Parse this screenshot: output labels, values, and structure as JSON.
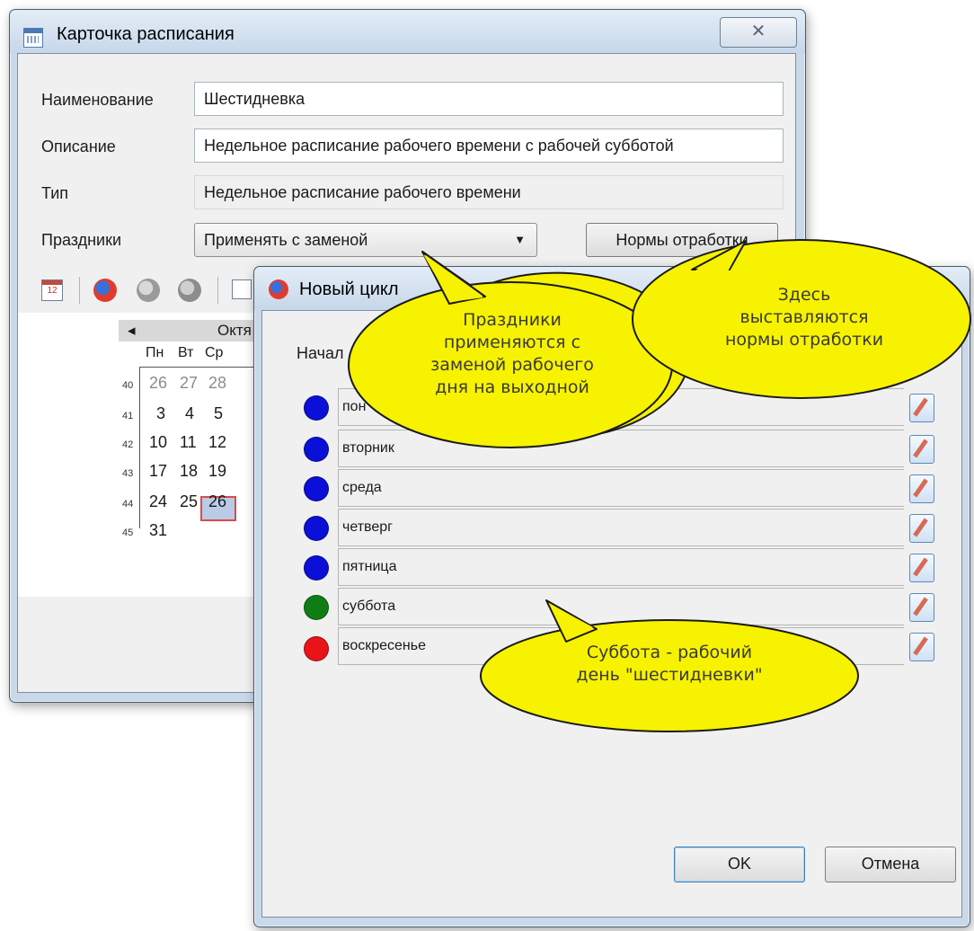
{
  "schedule_window": {
    "title": "Карточка расписания",
    "close_glyph": "✕",
    "fields": [
      {
        "label": "Наименование",
        "value": "Шестидневка"
      },
      {
        "label": "Описание",
        "value": "Недельное расписание рабочего времени с рабочей субботой"
      },
      {
        "label": "Тип",
        "value": "Недельное расписание рабочего времени"
      }
    ],
    "holidays": {
      "label": "Праздники",
      "selected": "Применять с заменой"
    },
    "norms_button": "Нормы отработки",
    "calendar": {
      "month_partial": "Октя",
      "nav_prev": "◂",
      "day_headers": [
        "Пн",
        "Вт",
        "Ср"
      ],
      "weeks": [
        {
          "num": "40",
          "days": [
            "26",
            "27",
            "28"
          ]
        },
        {
          "num": "41",
          "days": [
            "3",
            "4",
            "5"
          ]
        },
        {
          "num": "42",
          "days": [
            "10",
            "11",
            "12"
          ]
        },
        {
          "num": "43",
          "days": [
            "17",
            "18",
            "19"
          ]
        },
        {
          "num": "44",
          "days": [
            "24",
            "25",
            "26"
          ]
        },
        {
          "num": "45",
          "days": [
            "31"
          ]
        }
      ],
      "today": "26"
    }
  },
  "cycle_window": {
    "title_partial": "Новый цикл",
    "start_label_partial": "Начал",
    "days": [
      {
        "name": "пон",
        "color": "#0a10d8"
      },
      {
        "name": "вторник",
        "color": "#0a10d8"
      },
      {
        "name": "среда",
        "color": "#0a10d8"
      },
      {
        "name": "четверг",
        "color": "#0a10d8"
      },
      {
        "name": "пятница",
        "color": "#0a10d8"
      },
      {
        "name": "суббота",
        "color": "#107d14"
      },
      {
        "name": "воскресенье",
        "color": "#e8141a"
      }
    ],
    "ok_button": "OK",
    "cancel_button": "Отмена"
  },
  "callouts": {
    "holidays": [
      "Праздники",
      "применяются с",
      "заменой рабочего",
      "дня на выходной"
    ],
    "norms": [
      "Здесь",
      "выставляются",
      "нормы отработки"
    ],
    "saturday": [
      "Суббота - рабочий",
      "день \"шестидневки\""
    ],
    "fill_color": "#f7f200"
  }
}
